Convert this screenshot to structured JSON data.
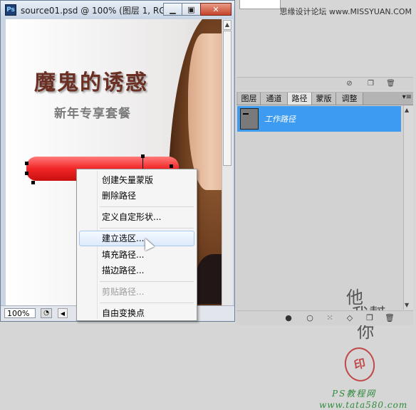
{
  "document": {
    "title": "source01.psd @ 100% (图层 1, RG...",
    "app_icon": "Ps",
    "window_buttons": {
      "minimize": "▁",
      "maximize": "▣",
      "close": "✕"
    },
    "canvas": {
      "headline": "魔鬼的诱惑",
      "subheadline": "新年专享套餐"
    },
    "zoom": "100%"
  },
  "context_menu": {
    "items": [
      {
        "label": "创建矢量蒙版",
        "enabled": true
      },
      {
        "label": "删除路径",
        "enabled": true
      },
      {
        "label": "定义自定形状...",
        "enabled": true
      },
      {
        "label": "建立选区...",
        "enabled": true,
        "highlighted": true
      },
      {
        "label": "填充路径...",
        "enabled": true
      },
      {
        "label": "描边路径...",
        "enabled": true
      },
      {
        "label": "剪贴路径...",
        "enabled": false
      },
      {
        "label": "自由变换点",
        "enabled": true
      }
    ]
  },
  "header_watermark": "思缘设计论坛 www.MISSYUAN.COM",
  "panels": {
    "tabs": [
      "图层",
      "通道",
      "路径",
      "蒙版",
      "调整"
    ],
    "active_tab": "路径",
    "paths": [
      {
        "name": "工作路径",
        "selected": true
      }
    ]
  },
  "watermark": {
    "brand": "PS教程网",
    "url": "www.tata580.com"
  },
  "colors": {
    "selection": "#3d9bf0",
    "red_button": "#f22626",
    "headline": "#6b2f23"
  }
}
